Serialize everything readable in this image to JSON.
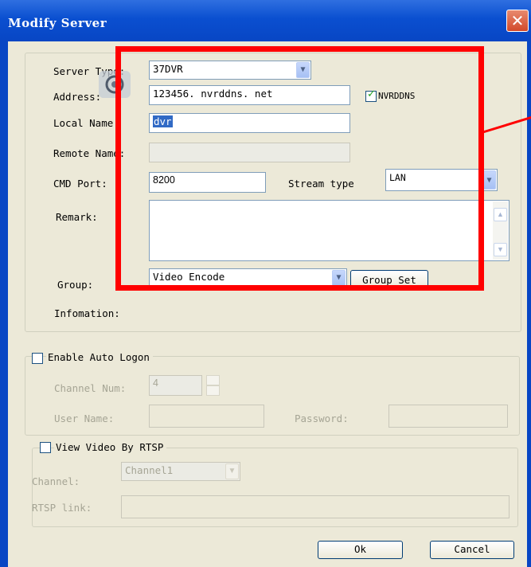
{
  "window": {
    "title": "Modify Server",
    "close_symbol": "✕"
  },
  "server": {
    "server_type_label": "Server Type:",
    "server_type_value": "37DVR",
    "address_label": "Address:",
    "address_value": "123456. nvrddns. net",
    "nvrddns_label": "NVRDDNS",
    "nvrddns_checked": true,
    "local_name_label": "Local Name:",
    "local_name_value": "dvr",
    "remote_name_label": "Remote Name:",
    "remote_name_value": "",
    "cmd_port_label": "CMD Port:",
    "cmd_port_value": "8200",
    "stream_type_label": "Stream type",
    "stream_type_value": "LAN",
    "remark_label": "Remark:",
    "remark_value": "",
    "group_label": "Group:",
    "group_value": "Video Encode",
    "group_set_label": "Group Set",
    "information_label": "Infomation:"
  },
  "auto_logon": {
    "enable_label": "Enable Auto Logon",
    "checked": false,
    "channel_num_label": "Channel Num:",
    "channel_num_value": "4",
    "user_name_label": "User Name:",
    "user_name_value": "",
    "password_label": "Password:",
    "password_value": ""
  },
  "rtsp": {
    "view_label": "View Video By RTSP",
    "checked": false,
    "channel_label": "Channel:",
    "channel_value": "Channel1",
    "rtsp_link_label": "RTSP link:",
    "rtsp_link_value": ""
  },
  "buttons": {
    "ok_label": "Ok",
    "cancel_label": "Cancel"
  },
  "annotation": {
    "highlight_color": "#ff0000"
  },
  "colors": {
    "titlebar": "#0a4fd0",
    "client": "#ece9d8",
    "selection": "#316ac5"
  }
}
